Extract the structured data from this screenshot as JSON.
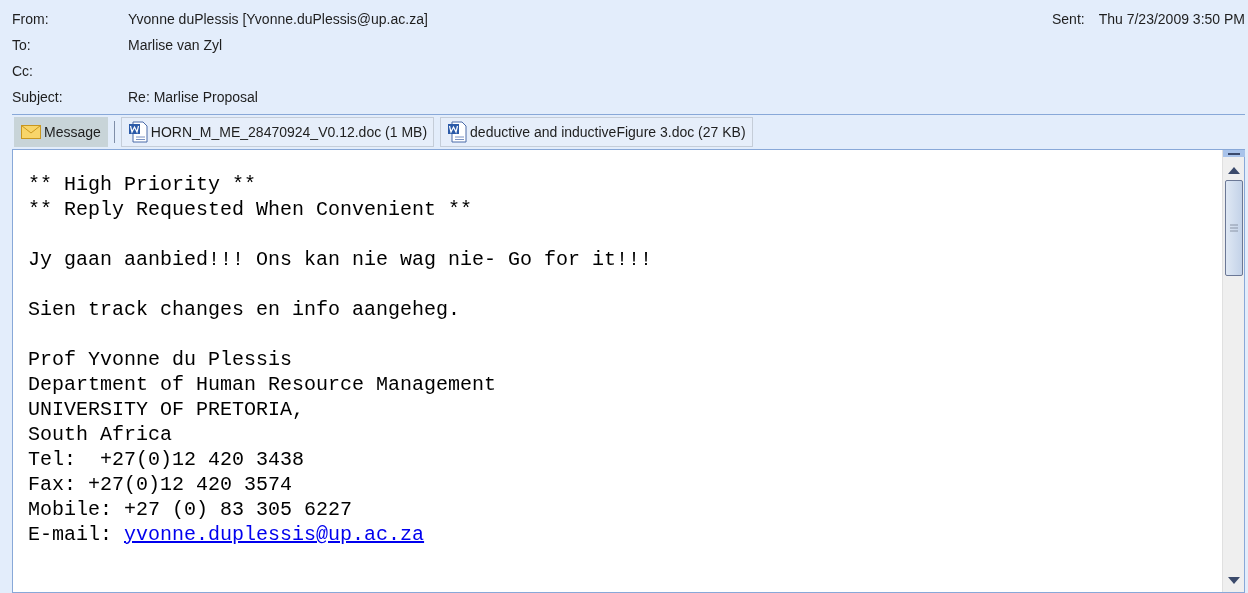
{
  "header": {
    "fields": [
      {
        "label": "From:",
        "value": "Yvonne duPlessis [Yvonne.duPlessis@up.ac.za]"
      },
      {
        "label": "To:",
        "value": "Marlise van Zyl"
      },
      {
        "label": "Cc:"
      },
      {
        "label": "Subject:",
        "value": "Re: Marlise Proposal"
      }
    ],
    "sent": {
      "label": "Sent:",
      "value": "Thu 7/23/2009 3:50 PM"
    }
  },
  "attachments": [
    {
      "kind": "message",
      "label": "Message",
      "selected": true
    },
    {
      "kind": "doc",
      "label": "HORN_M_ME_28470924_V0.12.doc (1 MB)",
      "selected": false
    },
    {
      "kind": "doc",
      "label": "deductive and inductiveFigure 3.doc (27 KB)",
      "selected": false
    }
  ],
  "body": {
    "paragraphs": [
      [
        {
          "text": "** High Priority **"
        },
        {
          "text": "** Reply Requested When Convenient **"
        }
      ],
      [
        {
          "text": "Jy gaan aanbied!!! Ons kan nie wag nie- Go for it!!!"
        }
      ],
      [
        {
          "text": "Sien track changes en info aangeheg."
        }
      ],
      [
        {
          "text": "Prof Yvonne du Plessis"
        },
        {
          "text": "Department of Human Resource Management"
        },
        {
          "text": "UNIVERSITY OF PRETORIA,"
        },
        {
          "text": "South Africa"
        },
        {
          "text": "Tel:  +27(0)12 420 3438"
        },
        {
          "text": "Fax: +27(0)12 420 3574"
        },
        {
          "text": "Mobile: +27 (0) 83 305 6227"
        },
        {
          "text": "E-mail: ",
          "link": "yvonne.duplessis@up.ac.za"
        }
      ]
    ]
  }
}
